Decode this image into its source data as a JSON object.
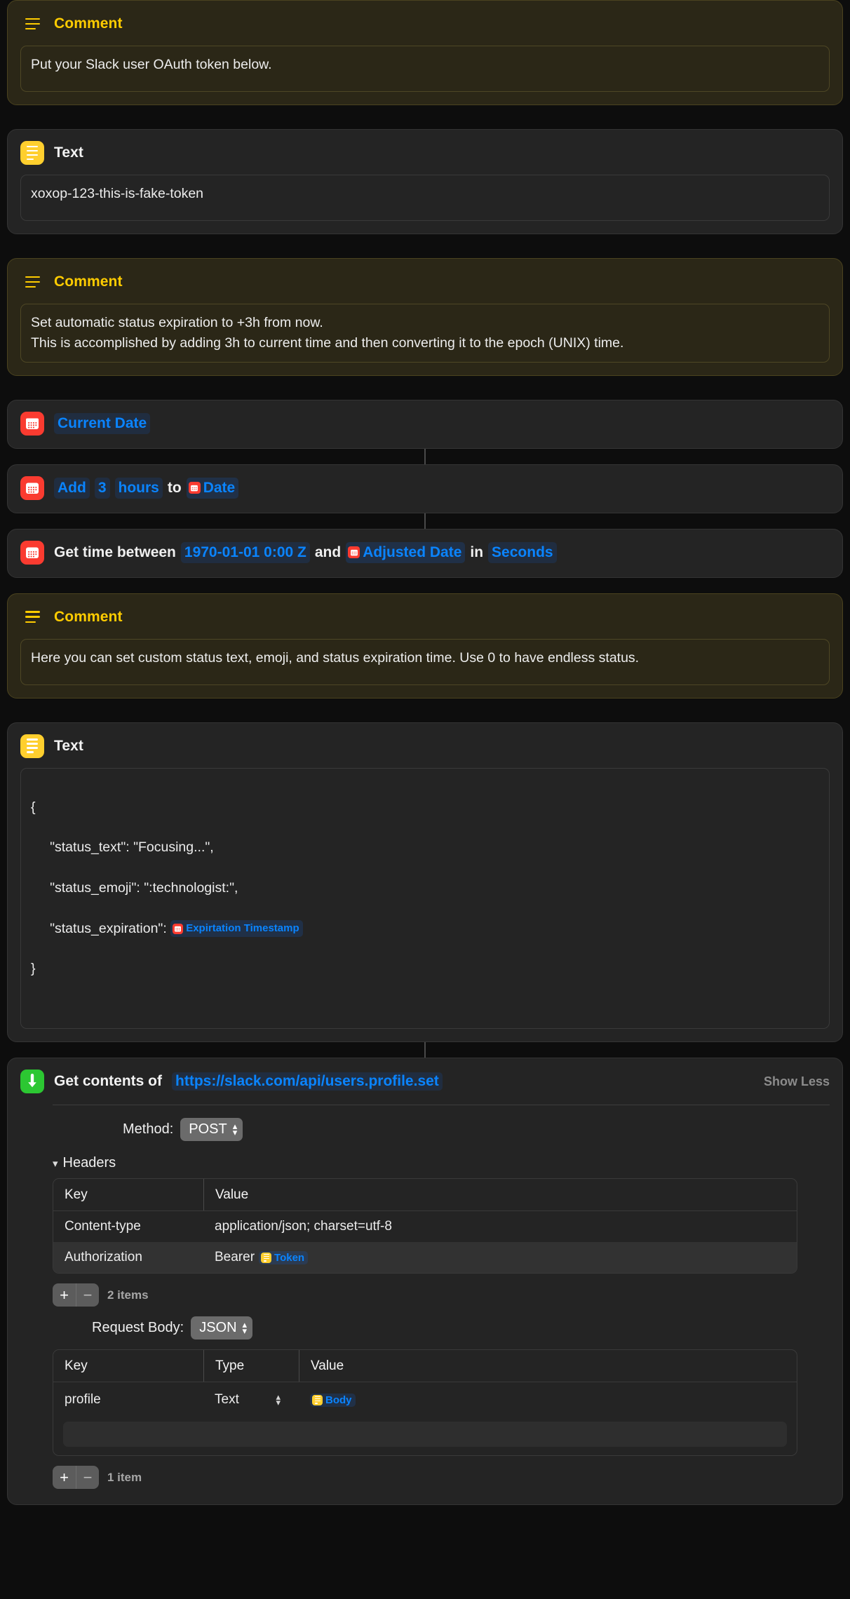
{
  "actions": [
    {
      "type": "comment",
      "icon": "comment-lines-icon",
      "title": "Comment",
      "text": "Put your Slack user OAuth token below."
    },
    {
      "type": "text",
      "icon": "text-icon",
      "title": "Text",
      "text": "xoxop-123-this-is-fake-token"
    },
    {
      "type": "comment",
      "icon": "comment-lines-icon",
      "title": "Comment",
      "text": "Set automatic status expiration to +3h from now.\nThis is accomplished by adding 3h to current time and then converting it to the epoch (UNIX) time."
    },
    {
      "type": "date",
      "icon": "calendar-icon",
      "params": [
        {
          "kind": "pill",
          "label": "Current Date"
        }
      ]
    },
    {
      "type": "date",
      "icon": "calendar-icon",
      "params": [
        {
          "kind": "pill",
          "label": "Add"
        },
        {
          "kind": "pill",
          "label": "3"
        },
        {
          "kind": "pill",
          "label": "hours"
        },
        {
          "kind": "lit",
          "label": "to"
        },
        {
          "kind": "token",
          "label": "Date",
          "token_icon": "calendar-icon"
        }
      ]
    },
    {
      "type": "date",
      "icon": "calendar-icon",
      "params": [
        {
          "kind": "lit",
          "label": "Get time between"
        },
        {
          "kind": "pill",
          "label": "1970-01-01 0:00 Z"
        },
        {
          "kind": "lit",
          "label": "and"
        },
        {
          "kind": "token",
          "label": "Adjusted Date",
          "token_icon": "calendar-icon"
        },
        {
          "kind": "lit",
          "label": "in"
        },
        {
          "kind": "pill",
          "label": "Seconds"
        }
      ]
    },
    {
      "type": "comment",
      "icon": "comment-lines-icon",
      "title": "Comment",
      "text": "Here you can set custom status text, emoji, and status expiration time. Use 0 to have endless status."
    }
  ],
  "text_json_action": {
    "icon": "text-icon",
    "title": "Text",
    "line1": "{",
    "line2": "     \"status_text\": \"Focusing...\",",
    "line3": "     \"status_emoji\": \":technologist:\",",
    "line4_prefix": "     \"status_expiration\": ",
    "line4_token": "Expirtation Timestamp",
    "line4_token_icon": "calendar-icon",
    "line5": "}"
  },
  "url_action": {
    "icon": "download-arrow-icon",
    "label": "Get contents of",
    "url": "https://slack.com/api/users.profile.set",
    "show_less": "Show Less",
    "method_label": "Method:",
    "method_value": "POST",
    "headers_disclosure": "Headers",
    "headers_table": {
      "columns": [
        "Key",
        "Value"
      ],
      "rows": [
        {
          "key": "Content-type",
          "value": "application/json; charset=utf-8",
          "token": null
        },
        {
          "key": "Authorization",
          "value": "Bearer",
          "token": "Token",
          "token_icon": "text-icon"
        }
      ]
    },
    "headers_count": "2 items",
    "request_body_label": "Request Body:",
    "request_body_value": "JSON",
    "body_table": {
      "columns": [
        "Key",
        "Type",
        "Value"
      ],
      "rows": [
        {
          "key": "profile",
          "type": "Text",
          "token": "Body",
          "token_icon": "text-icon"
        }
      ]
    },
    "body_count": "1 item",
    "add_label": "+",
    "remove_label": "−"
  },
  "colors": {
    "comment_bg": "#2b2717",
    "comment_accent": "#ffcc00",
    "card_bg": "#242424",
    "date_icon": "#fa3b30",
    "text_icon": "#ffcf2e",
    "url_icon": "#2cc732",
    "link_blue": "#0a84ff"
  }
}
